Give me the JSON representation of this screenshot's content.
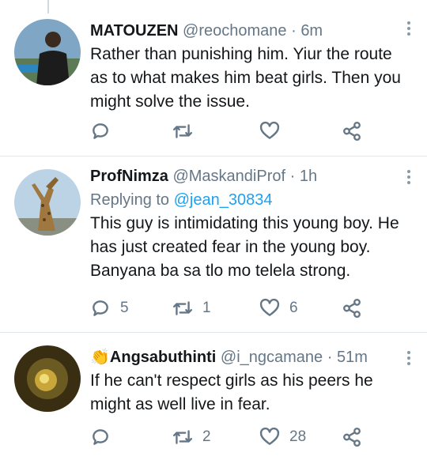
{
  "tweets": [
    {
      "name": "MATOUZEN",
      "handle": "@reochomane",
      "time": "6m",
      "replying_label": "",
      "replying_to": "",
      "text": "Rather than punishing him. Yiur the route as to what makes him beat girls. Then you might solve the issue.",
      "replies": "",
      "retweets": "",
      "likes": ""
    },
    {
      "name": "ProfNimza",
      "handle": "@MaskandiProf",
      "time": "1h",
      "replying_label": "Replying to",
      "replying_to": "@jean_30834",
      "text": "This guy is intimidating this young boy. He has just created fear in the young boy. Banyana ba sa tlo mo telela strong.",
      "replies": "5",
      "retweets": "1",
      "likes": "6"
    },
    {
      "name": "Angsabuthinti",
      "name_emoji": "👏",
      "handle": "@i_ngcamane",
      "time": "51m",
      "replying_label": "",
      "replying_to": "",
      "text": "If he can't respect girls as his peers he might as well live in fear.",
      "replies": "",
      "retweets": "2",
      "likes": "28"
    }
  ],
  "separator": " · ",
  "icons": {
    "reply": "reply-icon",
    "retweet": "retweet-icon",
    "like": "heart-icon",
    "share": "share-icon",
    "more": "more-vertical-icon"
  },
  "colors": {
    "text": "#14171a",
    "secondary": "#657786",
    "link": "#1da1f2",
    "divider": "#e1e8ed"
  }
}
